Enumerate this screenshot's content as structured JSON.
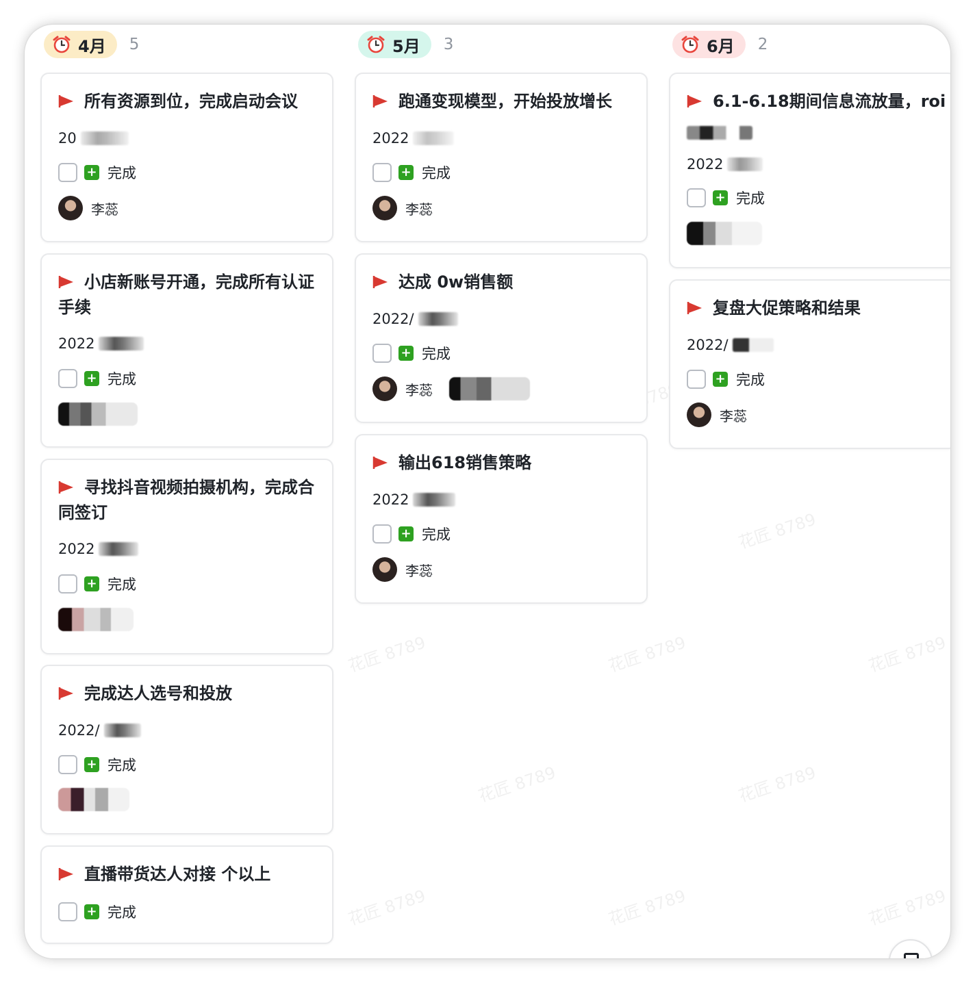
{
  "columns": [
    {
      "month": "4月",
      "count": "5",
      "pill_bg": "#fcecc6",
      "cards": [
        {
          "title": "所有资源到位，完成启动会议",
          "date": "20",
          "done": "完成",
          "owner": "李蕊"
        },
        {
          "title": "小店新账号开通，完成所有认证手续",
          "date": "2022",
          "done": "完成",
          "owner": ""
        },
        {
          "title": "寻找抖音视频拍摄机构，完成合同签订",
          "date": "2022",
          "done": "完成",
          "owner": ""
        },
        {
          "title": "完成达人选号和投放",
          "date": "2022/",
          "done": "完成",
          "owner": ""
        },
        {
          "title": "直播带货达人对接 个以上",
          "done": "完成"
        }
      ]
    },
    {
      "month": "5月",
      "count": "3",
      "pill_bg": "#d5f6ec",
      "cards": [
        {
          "title": "跑通变现模型，开始投放增长",
          "date": "2022",
          "done": "完成",
          "owner": "李蕊"
        },
        {
          "title": "达成 0w销售额",
          "date": "2022/",
          "done": "完成",
          "owner": "李蕊"
        },
        {
          "title": "输出618销售策略",
          "date": "2022",
          "done": "完成",
          "owner": "李蕊"
        }
      ]
    },
    {
      "month": "6月",
      "count": "2",
      "pill_bg": "#fde2e2",
      "cards": [
        {
          "title": "6.1-6.18期间信息流放量，roi",
          "date": "2022",
          "done": "完成",
          "owner": ""
        },
        {
          "title": "复盘大促策略和结果",
          "date": "2022/",
          "done": "完成",
          "owner": "李蕊"
        }
      ]
    }
  ],
  "watermark": "花匠 8789",
  "colors": {
    "flag": "#d83931",
    "done_icon": "#2ea121",
    "clock": "#e8453c"
  }
}
